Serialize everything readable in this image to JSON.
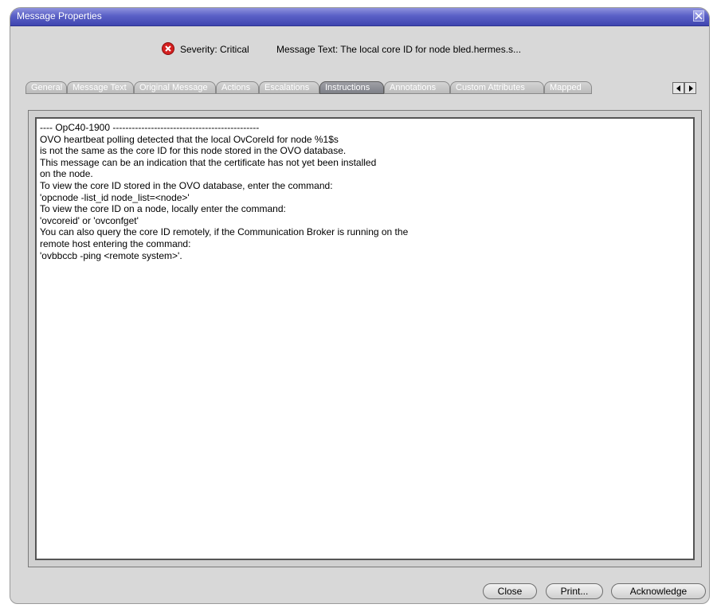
{
  "window": {
    "title": "Message Properties"
  },
  "summary": {
    "severity": "Severity: Critical",
    "message_text": "Message Text: The local core ID for node bled.hermes.s..."
  },
  "tabs": [
    {
      "label": "General",
      "active": false
    },
    {
      "label": "Message Text",
      "active": false
    },
    {
      "label": "Original Message",
      "active": false
    },
    {
      "label": "Actions",
      "active": false
    },
    {
      "label": "Escalations",
      "active": false
    },
    {
      "label": "Instructions",
      "active": true
    },
    {
      "label": "Annotations",
      "active": false
    },
    {
      "label": "Custom Attributes",
      "active": false
    },
    {
      "label": "Mapped",
      "active": false
    }
  ],
  "instructions": {
    "lines": [
      "---- OpC40-1900 ----------------------------------------------",
      "OVO heartbeat polling detected that the local OvCoreId for node %1$s",
      "is not the same as the core ID for this node stored in the OVO database.",
      "This message can be an indication that the certificate has not yet been installed",
      "on the node.",
      "To view the core ID stored in the OVO database, enter the command:",
      "'opcnode -list_id node_list=<node>'",
      "To view the core ID on a node, locally enter the command:",
      "'ovcoreid' or 'ovconfget'",
      "You can also query the core ID remotely, if the Communication Broker is running on the",
      "remote host entering the command:",
      "'ovbbccb -ping <remote system>'."
    ]
  },
  "buttons": {
    "close": "Close",
    "print": "Print...",
    "acknowledge": "Acknowledge"
  },
  "colors": {
    "titlebar": "#4a50b8",
    "severity_critical": "#d42020"
  }
}
